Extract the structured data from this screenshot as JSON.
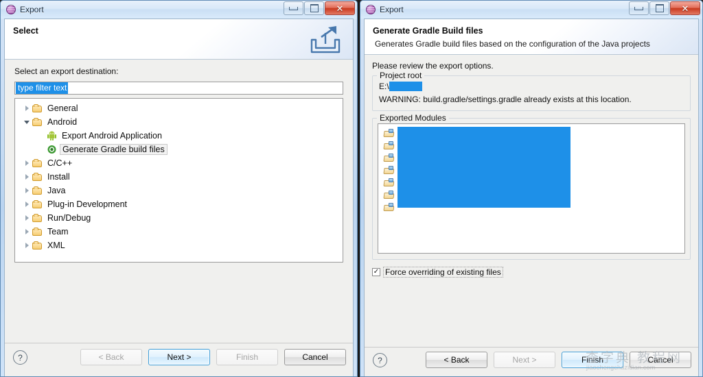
{
  "left_window": {
    "title": "Export",
    "icon": "eclipse-icon",
    "window_buttons": {
      "minimize": "minimize-icon",
      "maximize": "restore-icon",
      "close": "close-icon"
    },
    "wizard": {
      "title": "Select",
      "header_icon": "export-arrow-icon"
    },
    "prompt": "Select an export destination:",
    "filter": {
      "value": "type filter text",
      "placeholder": "type filter text"
    },
    "tree": [
      {
        "label": "General",
        "icon": "folder-icon",
        "state": "collapsed",
        "level": 0
      },
      {
        "label": "Android",
        "icon": "folder-icon",
        "state": "expanded",
        "level": 0
      },
      {
        "label": "Export Android Application",
        "icon": "android-robot-icon",
        "state": "leaf",
        "level": 1
      },
      {
        "label": "Generate Gradle build files",
        "icon": "gradle-icon",
        "state": "leaf",
        "level": 1,
        "selected": true
      },
      {
        "label": "C/C++",
        "icon": "folder-icon",
        "state": "collapsed",
        "level": 0
      },
      {
        "label": "Install",
        "icon": "folder-icon",
        "state": "collapsed",
        "level": 0
      },
      {
        "label": "Java",
        "icon": "folder-icon",
        "state": "collapsed",
        "level": 0
      },
      {
        "label": "Plug-in Development",
        "icon": "folder-icon",
        "state": "collapsed",
        "level": 0
      },
      {
        "label": "Run/Debug",
        "icon": "folder-icon",
        "state": "collapsed",
        "level": 0
      },
      {
        "label": "Team",
        "icon": "folder-icon",
        "state": "collapsed",
        "level": 0
      },
      {
        "label": "XML",
        "icon": "folder-icon",
        "state": "collapsed",
        "level": 0
      }
    ],
    "buttons": {
      "help": "?",
      "back": "< Back",
      "next": "Next >",
      "finish": "Finish",
      "cancel": "Cancel"
    }
  },
  "right_window": {
    "title": "Export",
    "icon": "eclipse-icon",
    "window_buttons": {
      "minimize": "minimize-icon",
      "maximize": "restore-icon",
      "close": "close-icon"
    },
    "wizard": {
      "title": "Generate Gradle Build files",
      "description": "Generates Gradle build files based on the configuration of the Java projects"
    },
    "intro": "Please review the export options.",
    "project_root": {
      "group_title": "Project root",
      "path_prefix": "E:\\",
      "path_redacted": true,
      "warning": "WARNING: build.gradle/settings.gradle already exists at this location."
    },
    "exported_modules": {
      "group_title": "Exported Modules",
      "rows": [
        {
          "icon": "project-folder-icon",
          "label_redacted": true
        },
        {
          "icon": "project-folder-icon",
          "label_redacted": true
        },
        {
          "icon": "project-folder-icon",
          "label_redacted": true
        },
        {
          "icon": "project-folder-icon",
          "label_redacted": true
        },
        {
          "icon": "project-folder-icon",
          "label_redacted": true
        },
        {
          "icon": "project-folder-icon",
          "label_redacted": true
        },
        {
          "icon": "project-folder-icon",
          "label_redacted": true
        }
      ]
    },
    "force_override": {
      "label": "Force overriding of existing files",
      "checked": true,
      "checkmark": "✓"
    },
    "buttons": {
      "help": "?",
      "back": "< Back",
      "next": "Next >",
      "finish": "Finish",
      "cancel": "Cancel"
    }
  },
  "watermark": {
    "text": "查字典 教程网",
    "url": "jiaochengchazidian.com"
  },
  "colors": {
    "selection_blue": "#1e90e8",
    "title_gradient_top": "#e8f1fb",
    "close_red": "#c8391f",
    "folder_yellow": "#f7cd72",
    "android_green": "#a4c639"
  }
}
